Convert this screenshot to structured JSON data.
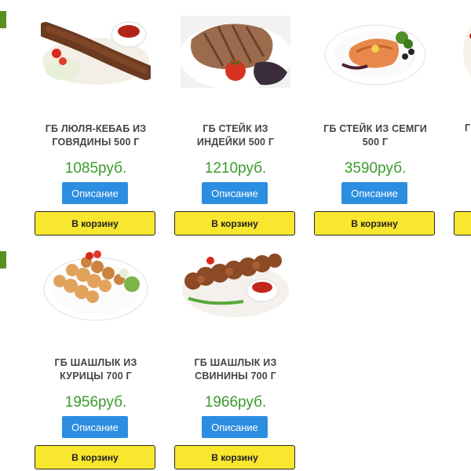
{
  "products": [
    {
      "title_line1": "ГБ ЛЮЛЯ-КЕБАБ ИЗ",
      "title_line2": "ГОВЯДИНЫ 500 Г",
      "price": "1085руб.",
      "desc_label": "Описание",
      "cart_label": "В корзину"
    },
    {
      "title_line1": "ГБ СТЕЙК ИЗ",
      "title_line2": "ИНДЕЙКИ 500 Г",
      "price": "1210руб.",
      "desc_label": "Описание",
      "cart_label": "В корзину"
    },
    {
      "title_line1": "ГБ СТЕЙК ИЗ СЕМГИ",
      "title_line2": "500 Г",
      "price": "3590руб.",
      "desc_label": "Описание",
      "cart_label": "В корзину"
    },
    {
      "title_line1": "Г",
      "title_line2": "",
      "price": "",
      "desc_label": "",
      "cart_label": ""
    },
    {
      "title_line1": "ГБ ШАШЛЫК ИЗ",
      "title_line2": "КУРИЦЫ 700 Г",
      "price": "1956руб.",
      "desc_label": "Описание",
      "cart_label": "В корзину"
    },
    {
      "title_line1": "ГБ ШАШЛЫК ИЗ",
      "title_line2": "СВИНИНЫ 700 Г",
      "price": "1966руб.",
      "desc_label": "Описание",
      "cart_label": "В корзину"
    }
  ],
  "colors": {
    "price": "#3c9a2c",
    "description_button": "#2c8ee0",
    "cart_button": "#f9e62e",
    "side_marker": "#5a8f1f"
  },
  "icons": [
    "lula-kebab-photo",
    "turkey-steak-photo",
    "salmon-steak-photo",
    "partial-dish-photo",
    "chicken-shashlik-photo",
    "pork-shashlik-photo"
  ]
}
